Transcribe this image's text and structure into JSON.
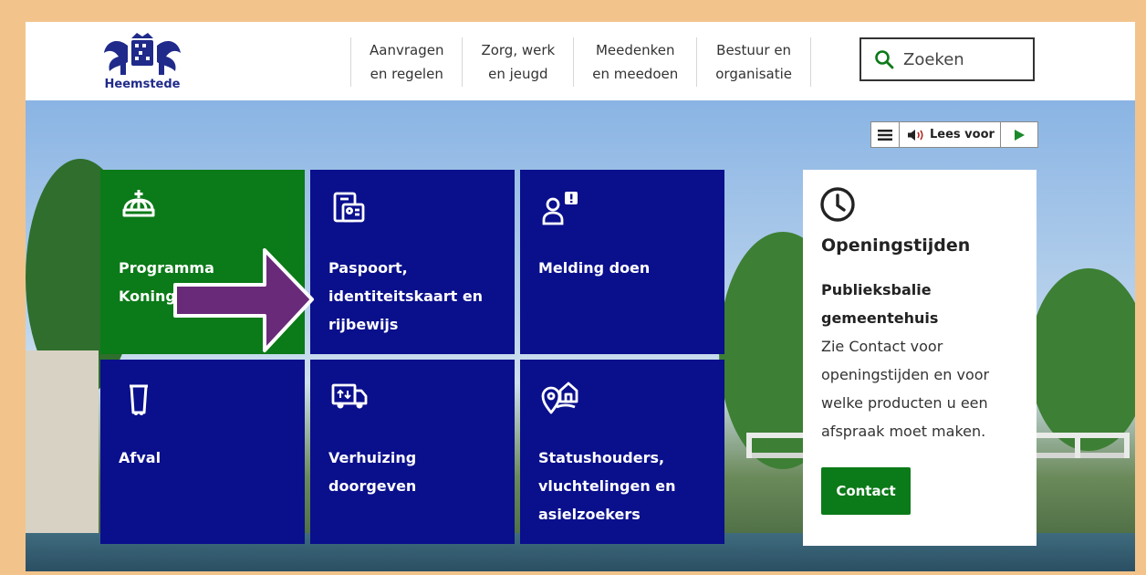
{
  "header": {
    "logo_text": "Heemstede",
    "nav": [
      {
        "label": "Aanvragen\nen regelen"
      },
      {
        "label": "Zorg, werk\nen jeugd"
      },
      {
        "label": "Meedenken\nen meedoen"
      },
      {
        "label": "Bestuur en\norganisatie"
      }
    ],
    "search": {
      "placeholder": "Zoeken",
      "icon": "search-icon"
    }
  },
  "readspeaker": {
    "label": "Lees voor",
    "menu_icon": "menu-icon",
    "speaker_icon": "speaker-icon",
    "play_icon": "play-icon"
  },
  "tiles": [
    {
      "label": "Programma Koningsdag",
      "icon": "crown-icon",
      "color": "#0b7a18"
    },
    {
      "label": "Paspoort, identiteitskaart en rijbewijs",
      "icon": "id-card-icon",
      "color": "#0a0f8c"
    },
    {
      "label": "Melding doen",
      "icon": "report-person-icon",
      "color": "#0a0f8c"
    },
    {
      "label": "Afval",
      "icon": "trash-bin-icon",
      "color": "#0a0f8c"
    },
    {
      "label": "Verhuizing doorgeven",
      "icon": "moving-truck-icon",
      "color": "#0a0f8c"
    },
    {
      "label": "Statushouders, vluchtelingen en asielzoekers",
      "icon": "location-home-icon",
      "color": "#0a0f8c"
    }
  ],
  "hours": {
    "icon": "clock-icon",
    "title": "Openingstijden",
    "subtitle": "Publieksbalie gemeentehuis",
    "description": "Zie Contact voor openingstijden en voor welke producten u een afspraak moet maken.",
    "button": "Contact"
  },
  "annotation": {
    "arrow_color": "#6a2a7a"
  }
}
